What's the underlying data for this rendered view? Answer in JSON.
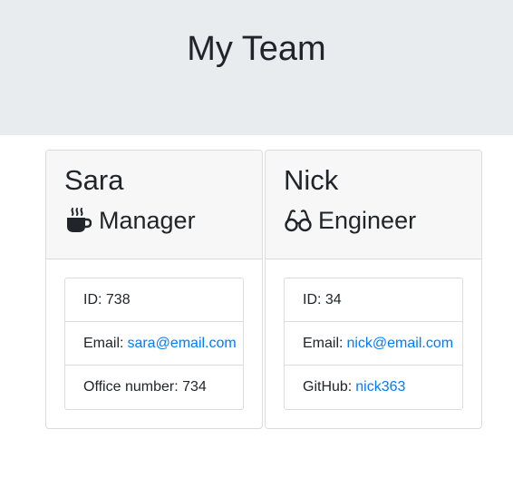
{
  "header": {
    "title": "My Team"
  },
  "cards": [
    {
      "name": "Sara",
      "role": "Manager",
      "role_icon": "coffee-icon",
      "details": [
        {
          "label": "ID: 738",
          "link": ""
        },
        {
          "label": "Email:",
          "link": "sara@email.com"
        },
        {
          "label": "Office number: 734",
          "link": ""
        }
      ]
    },
    {
      "name": "Nick",
      "role": "Engineer",
      "role_icon": "glasses-icon",
      "details": [
        {
          "label": "ID: 34",
          "link": ""
        },
        {
          "label": "Email:",
          "link": "nick@email.com"
        },
        {
          "label": "GitHub:",
          "link": "nick363"
        }
      ]
    }
  ],
  "colors": {
    "header_bg": "#e9ecef",
    "link": "#007bff",
    "card_header_bg": "#f7f7f7"
  }
}
